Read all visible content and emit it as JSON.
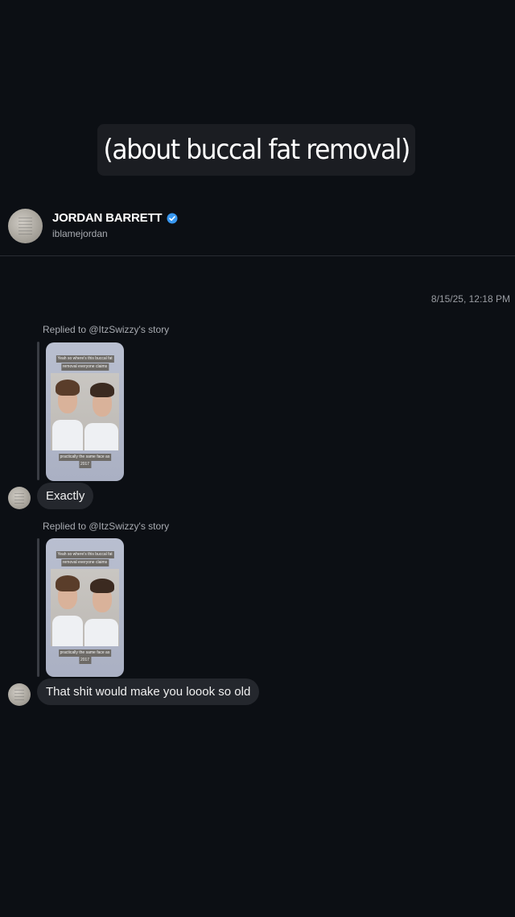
{
  "caption": "(about buccal fat removal)",
  "header": {
    "name": "JORDAN BARRETT",
    "handle": "iblamejordan"
  },
  "timestamp": "8/15/25, 12:18 PM",
  "messages": [
    {
      "reply_label": "Replied to @ItzSwizzy's story",
      "story_caption_top_1": "Yeah so where's this buccal fat",
      "story_caption_top_2": "removal everyone claims",
      "story_caption_bottom_1": "practically the same face as",
      "story_caption_bottom_2": "2017",
      "text": "Exactly"
    },
    {
      "reply_label": "Replied to @ItzSwizzy's story",
      "story_caption_top_1": "Yeah so where's this buccal fat",
      "story_caption_top_2": "removal everyone claims",
      "story_caption_bottom_1": "practically the same face as",
      "story_caption_bottom_2": "2017",
      "text": "That shit would make you loook so old"
    }
  ],
  "colors": {
    "background": "#0c0f14",
    "bubble": "#24272d",
    "verified": "#3897f0"
  }
}
